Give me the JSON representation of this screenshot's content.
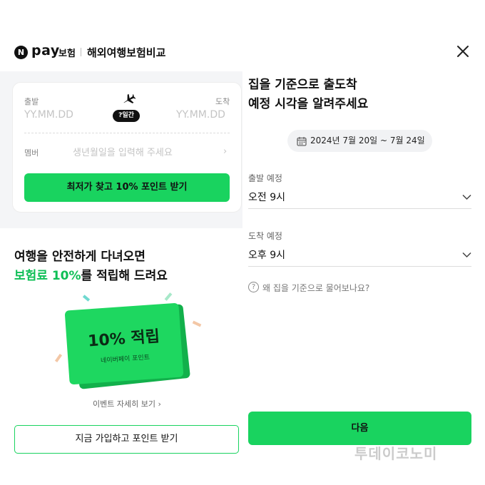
{
  "header": {
    "logo_n": "N",
    "logo_pay": "pay",
    "logo_sub": "보험",
    "title": "해외여행보험비교",
    "close_icon": "close-icon"
  },
  "search_card": {
    "departure_label": "출발",
    "arrival_label": "도착",
    "departure_placeholder": "YY.MM.DD",
    "arrival_placeholder": "YY.MM.DD",
    "days_badge": "?일간",
    "member_label": "멤버",
    "member_placeholder": "생년월일을 입력해 주세요",
    "member_chevron": "›",
    "cta_label": "최저가 찾고 10% 포인트 받기"
  },
  "promo": {
    "line1": "여행을 안전하게 다녀오면",
    "line2_highlight": "보험료 10%",
    "line2_rest": "를 적립해 드려요",
    "card_title": "10% 적립",
    "card_subtitle": "네이버페이 포인트",
    "event_link": "이벤트 자세히 보기 ›",
    "join_button": "지금 가입하고 포인트 받기"
  },
  "itinerary": {
    "title_line1": "집을 기준으로 출도착",
    "title_line2": "예정 시각을 알려주세요",
    "date_range": "2024년 7월 20일 ~ 7월 24일",
    "departure_label": "출발 예정",
    "departure_value": "오전 9시",
    "arrival_label": "도착 예정",
    "arrival_value": "오후 9시",
    "help_icon": "?",
    "help_text": "왜 집을 기준으로 물어보나요?",
    "next_button": "다음"
  },
  "watermark": "투데이코노미",
  "colors": {
    "accent": "#19d35f",
    "highlight_text": "#0fbf56",
    "left_panel_bg": "#f4f5f7",
    "chip_bg": "#f1f2f4"
  }
}
